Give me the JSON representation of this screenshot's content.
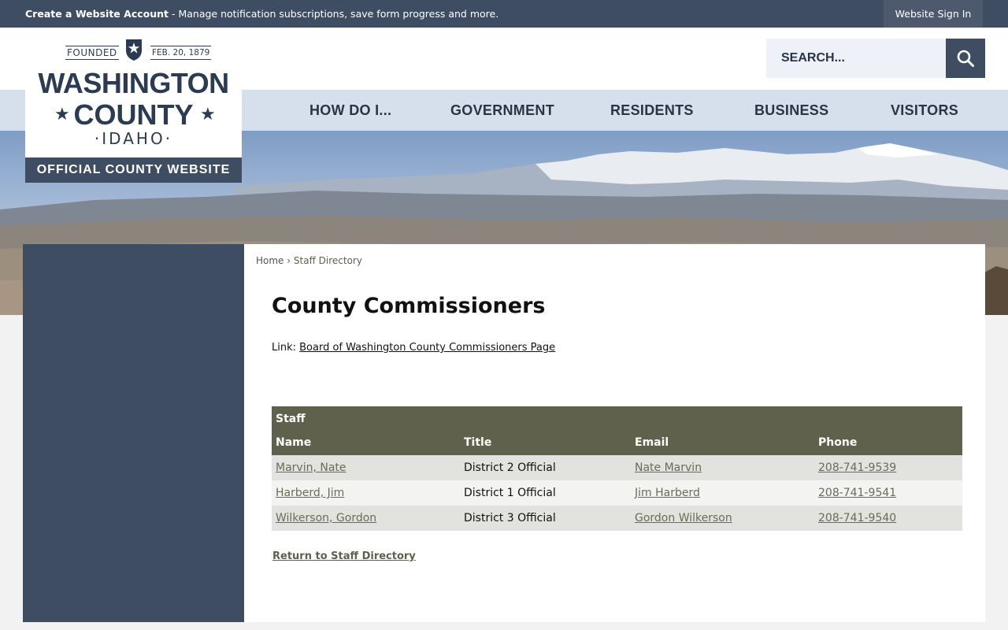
{
  "topbar": {
    "create_account": "Create a Website Account",
    "message": " - Manage notification subscriptions, save form progress and more.",
    "sign_in": "Website Sign In"
  },
  "logo": {
    "founded": "FOUNDED",
    "date": "FEB. 20, 1879",
    "line1": "WASHINGTON",
    "line2": "COUNTY",
    "state": "IDAHO",
    "tagline": "OFFICIAL COUNTY WEBSITE",
    "star": "★",
    "badge_icon": "shield-star"
  },
  "search": {
    "placeholder": "SEARCH...",
    "icon": "search-icon"
  },
  "nav": {
    "items": [
      {
        "label": "HOW DO I..."
      },
      {
        "label": "GOVERNMENT"
      },
      {
        "label": "RESIDENTS"
      },
      {
        "label": "BUSINESS"
      },
      {
        "label": "VISITORS"
      }
    ]
  },
  "breadcrumb": {
    "home": "Home",
    "separator": "›",
    "current": "Staff Directory"
  },
  "page": {
    "title": "County Commissioners",
    "link_prefix": "Link: ",
    "link_text": "Board of Washington County Commissioners Page",
    "return_link": "Return to Staff Directory"
  },
  "staff_table": {
    "caption": "Staff",
    "headers": [
      "Name",
      "Title",
      "Email",
      "Phone"
    ],
    "rows": [
      {
        "name": "Marvin, Nate",
        "title": "District 2 Official",
        "email": "Nate Marvin",
        "phone": "208-741-9539"
      },
      {
        "name": "Harberd, Jim",
        "title": "District 1 Official",
        "email": "Jim Harberd",
        "phone": "208-741-9541"
      },
      {
        "name": "Wilkerson, Gordon",
        "title": "District 3 Official",
        "email": "Gordon Wilkerson",
        "phone": "208-741-9540"
      }
    ]
  },
  "colors": {
    "topbar": "#3e4d61",
    "nav_band": "#d6e0ec",
    "table_header": "#5f614c",
    "sidebar": "#3e4d61"
  }
}
